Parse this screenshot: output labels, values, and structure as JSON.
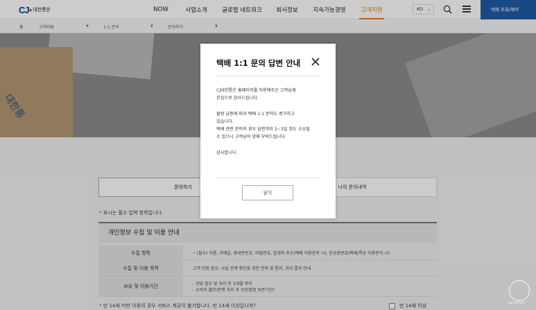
{
  "header": {
    "logo_mark": "CJ",
    "logo_text": "대한통운",
    "nav": [
      {
        "label": "NOW"
      },
      {
        "label": "사업소개"
      },
      {
        "label": "글로벌 네트워크"
      },
      {
        "label": "회사정보"
      },
      {
        "label": "지속가능경영"
      },
      {
        "label": "고객지원"
      }
    ],
    "lang": "KO",
    "track_button": "택배 조회/예약"
  },
  "breadcrumb": {
    "home": "홈",
    "level1": "고객지원",
    "level2": "1:1 문의",
    "level3": "문의하기"
  },
  "hero": {
    "card_text": "대한통"
  },
  "tabs": {
    "inquiry": "문의하기",
    "history": "나의 문의내역"
  },
  "required_note": "표시는 필수 입력 항목입니다.",
  "privacy": {
    "title": "개인정보 수집 및 이용 안내",
    "rows": [
      {
        "label": "수집 항목",
        "value": "(필수) 이름, 이메일, 휴대폰번호, 비밀번호, 발생지 주소(택배 이용문의 시), 운송장번호(택배/특송 이용문의 시)"
      },
      {
        "label": "수집 및 이용 목적",
        "value": "고객 민원 접수, 사실 관계 확인을 위한 연락 및 통지, 처리 결과 안내"
      },
      {
        "label": "보유 및 이용기간",
        "value1": "- 상담 접수 및 처리 후 3개월 까지",
        "value2": "- 소비자 불만/분쟁 처리 후 3년(법정 보존기간)"
      }
    ]
  },
  "age": {
    "question": "만 14세 미만 아동의 경우 서비스 제공이 불가합니다. 만 14세 이상입니까?",
    "check_label": "만 14세 이상"
  },
  "modal": {
    "title": "택배 1:1 문의 답변 안내",
    "p1_l1": "CJ대한통운 홈페이지를 이용해주신 고객님께",
    "p1_l2": "진심으로 감사드립니다.",
    "p2_l1": "물량 급증에 따라 택배 1:1 문의도 증가하고",
    "p2_l2": "있습니다.",
    "p2_l3": "택배 관련 문의의 경우 답변까지 2~3일 정도 소요될",
    "p2_l4": "수 있으니 고객님의 양해 부탁드립니다.",
    "p3": "감사합니다.",
    "close_button": "닫기"
  },
  "watermark": "jucelyn",
  "colors": {
    "accent": "#e37c24",
    "brand_blue": "#1f5ca6"
  }
}
